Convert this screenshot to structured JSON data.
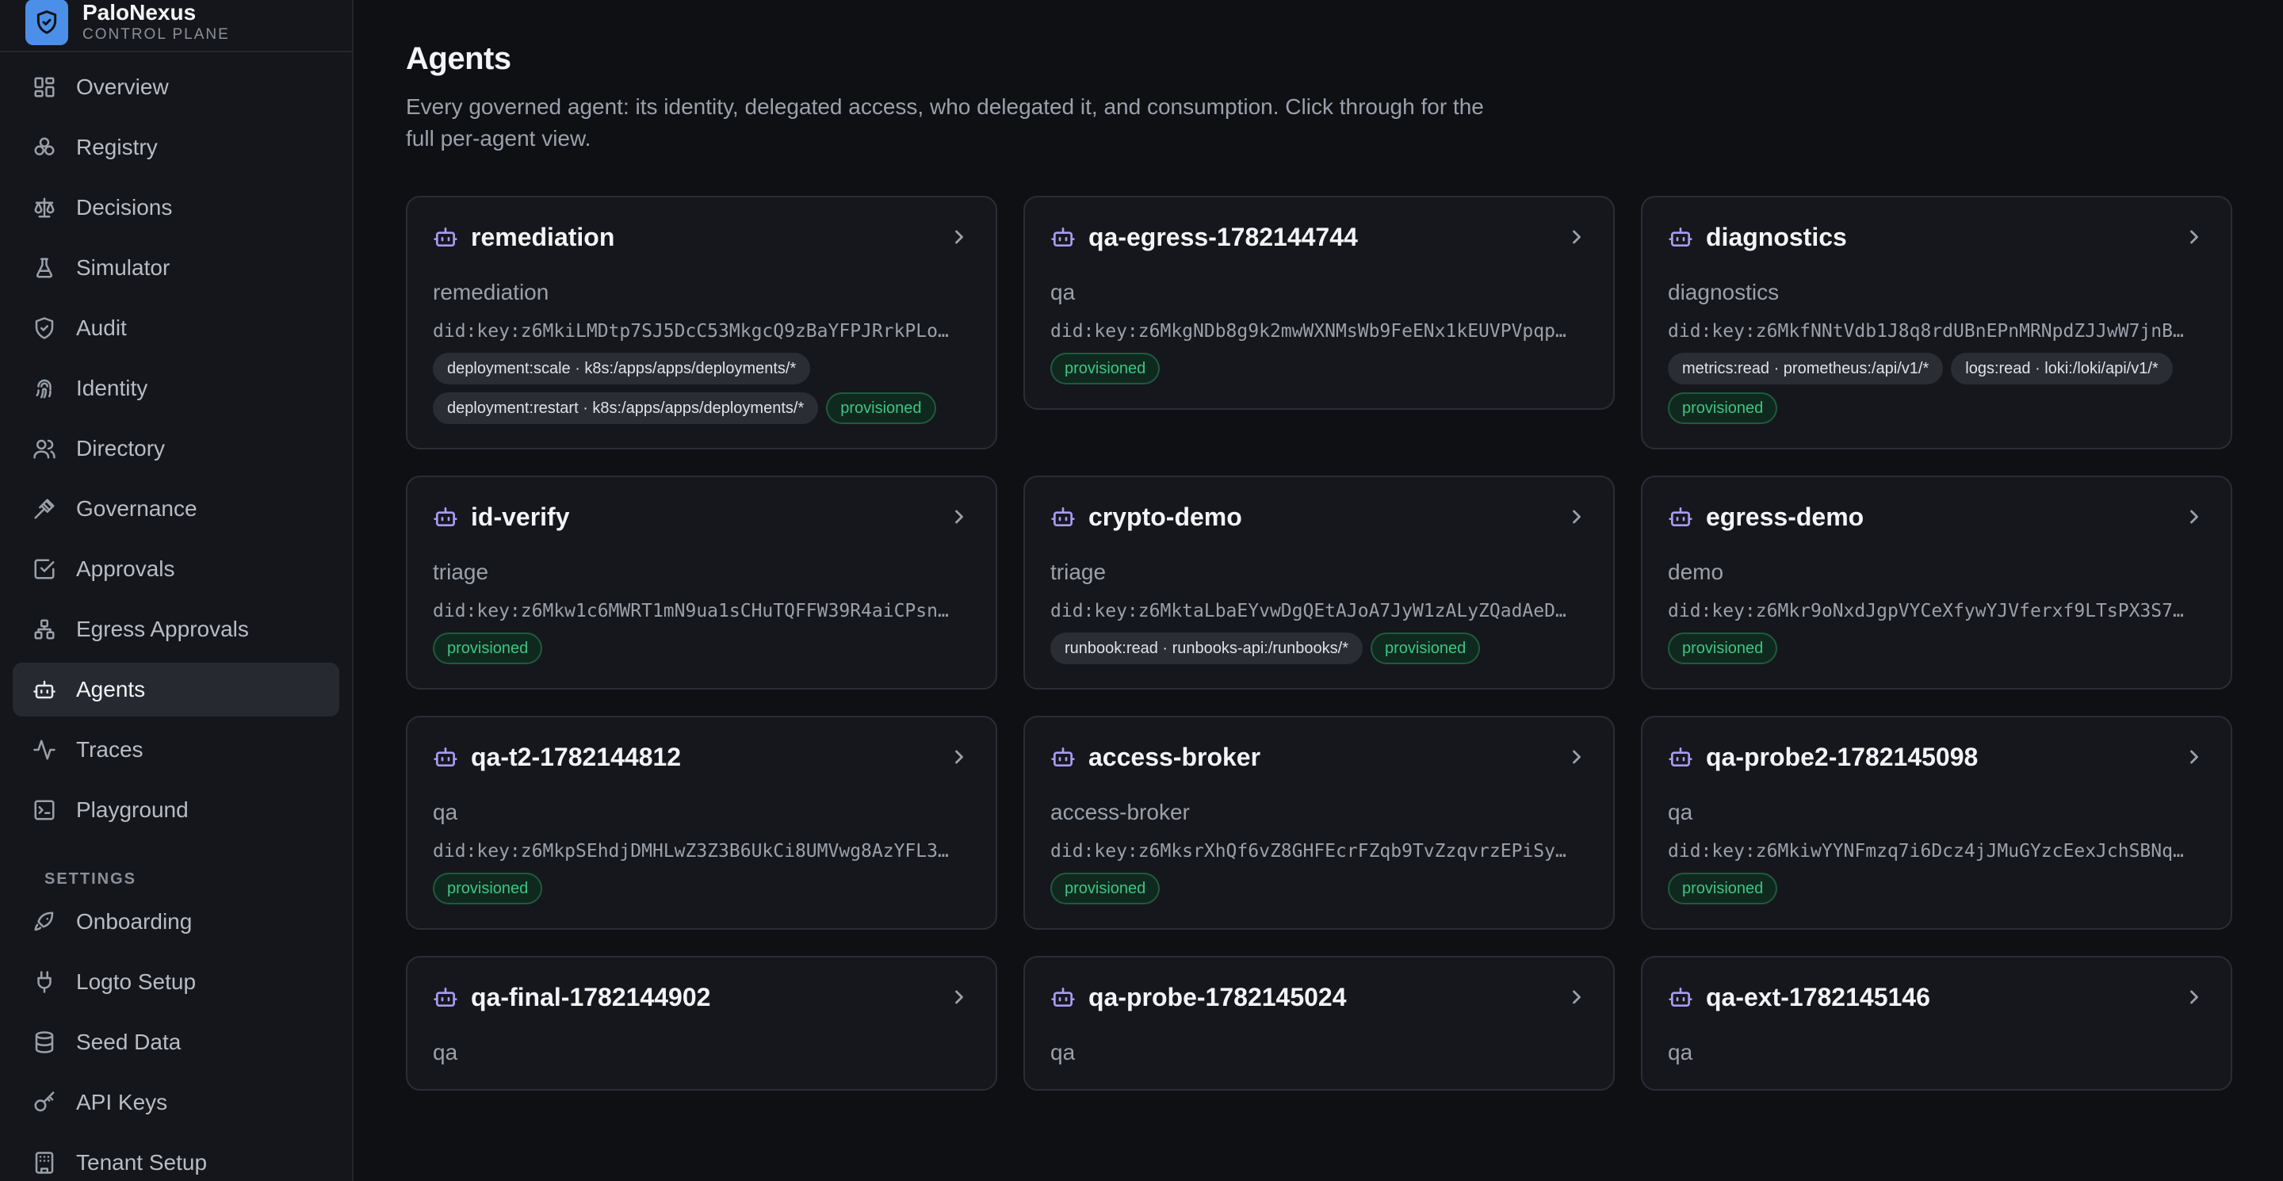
{
  "brand": {
    "name": "PaloNexus",
    "subtitle": "CONTROL PLANE"
  },
  "nav": {
    "items": [
      {
        "label": "Overview",
        "icon": "layout-grid-icon"
      },
      {
        "label": "Registry",
        "icon": "boxes-icon"
      },
      {
        "label": "Decisions",
        "icon": "scale-icon"
      },
      {
        "label": "Simulator",
        "icon": "flask-icon"
      },
      {
        "label": "Audit",
        "icon": "shield-check-icon"
      },
      {
        "label": "Identity",
        "icon": "fingerprint-icon"
      },
      {
        "label": "Directory",
        "icon": "users-icon"
      },
      {
        "label": "Governance",
        "icon": "gavel-icon"
      },
      {
        "label": "Approvals",
        "icon": "check-square-icon"
      },
      {
        "label": "Egress Approvals",
        "icon": "workflow-icon"
      },
      {
        "label": "Agents",
        "icon": "bot-icon",
        "active": true
      },
      {
        "label": "Traces",
        "icon": "activity-icon"
      },
      {
        "label": "Playground",
        "icon": "terminal-icon"
      }
    ],
    "settings_label": "SETTINGS",
    "settings_items": [
      {
        "label": "Onboarding",
        "icon": "rocket-icon"
      },
      {
        "label": "Logto Setup",
        "icon": "plug-icon"
      },
      {
        "label": "Seed Data",
        "icon": "database-icon"
      },
      {
        "label": "API Keys",
        "icon": "key-icon"
      },
      {
        "label": "Tenant Setup",
        "icon": "building-icon"
      }
    ]
  },
  "page": {
    "title": "Agents",
    "description": "Every governed agent: its identity, delegated access, who delegated it, and consumption. Click through for the full per-agent view."
  },
  "agents": [
    {
      "name": "remediation",
      "role": "remediation",
      "did": "did:key:z6MkiLMDtp7SJ5DcC53MkgcQ9zBaYFPJRrkPLo…",
      "scopes": [
        "deployment:scale · k8s:/apps/apps/deployments/*",
        "deployment:restart · k8s:/apps/apps/deployments/*"
      ],
      "status": "provisioned"
    },
    {
      "name": "qa-egress-1782144744",
      "role": "qa",
      "did": "did:key:z6MkgNDb8g9k2mwWXNMsWb9FeENx1kEUVPVpqp…",
      "scopes": [],
      "status": "provisioned"
    },
    {
      "name": "diagnostics",
      "role": "diagnostics",
      "did": "did:key:z6MkfNNtVdb1J8q8rdUBnEPnMRNpdZJJwW7jnB…",
      "scopes": [
        "metrics:read · prometheus:/api/v1/*",
        "logs:read · loki:/loki/api/v1/*"
      ],
      "status": "provisioned"
    },
    {
      "name": "id-verify",
      "role": "triage",
      "did": "did:key:z6Mkw1c6MWRT1mN9ua1sCHuTQFFW39R4aiCPsn…",
      "scopes": [],
      "status": "provisioned"
    },
    {
      "name": "crypto-demo",
      "role": "triage",
      "did": "did:key:z6MktaLbaEYvwDgQEtAJoA7JyW1zALyZQadAeD…",
      "scopes": [
        "runbook:read · runbooks-api:/runbooks/*"
      ],
      "status": "provisioned"
    },
    {
      "name": "egress-demo",
      "role": "demo",
      "did": "did:key:z6Mkr9oNxdJgpVYCeXfywYJVferxf9LTsPX3S7…",
      "scopes": [],
      "status": "provisioned"
    },
    {
      "name": "qa-t2-1782144812",
      "role": "qa",
      "did": "did:key:z6MkpSEhdjDMHLwZ3Z3B6UkCi8UMVwg8AzYFL3…",
      "scopes": [],
      "status": "provisioned"
    },
    {
      "name": "access-broker",
      "role": "access-broker",
      "did": "did:key:z6MksrXhQf6vZ8GHFEcrFZqb9TvZzqvrzEPiSy…",
      "scopes": [],
      "status": "provisioned"
    },
    {
      "name": "qa-probe2-1782145098",
      "role": "qa",
      "did": "did:key:z6MkiwYYNFmzq7i6Dcz4jJMuGYzcEexJchSBNq…",
      "scopes": [],
      "status": "provisioned"
    },
    {
      "name": "qa-final-1782144902",
      "role": "qa",
      "did": "",
      "scopes": [],
      "status": ""
    },
    {
      "name": "qa-probe-1782145024",
      "role": "qa",
      "did": "",
      "scopes": [],
      "status": ""
    },
    {
      "name": "qa-ext-1782145146",
      "role": "qa",
      "did": "",
      "scopes": [],
      "status": ""
    }
  ],
  "colors": {
    "accent": "#4b8fe8",
    "bot_icon": "#a99bf0",
    "provisioned": "#3fc483"
  }
}
